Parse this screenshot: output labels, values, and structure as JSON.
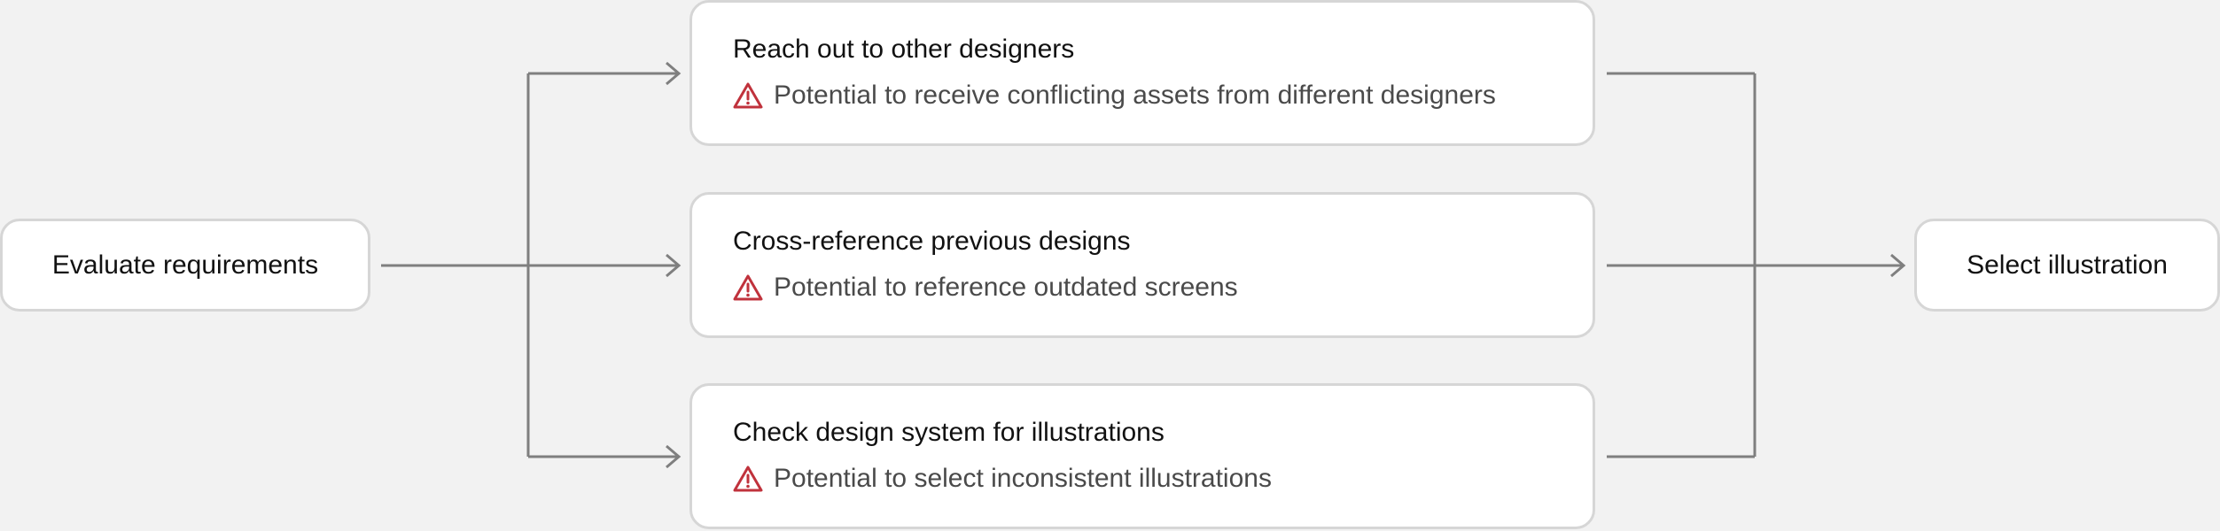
{
  "start": {
    "label": "Evaluate requirements"
  },
  "end": {
    "label": "Select illustration"
  },
  "steps": [
    {
      "title": "Reach out to other designers",
      "risk": "Potential to receive conflicting assets from different designers"
    },
    {
      "title": "Cross-reference previous designs",
      "risk": "Potential to reference outdated screens"
    },
    {
      "title": "Check design system for illustrations",
      "risk": "Potential to select inconsistent illustrations"
    }
  ],
  "colors": {
    "background": "#f2f2f2",
    "node_border": "#d6d6d6",
    "connector": "#7f7f7f",
    "warning": "#c0323c"
  }
}
